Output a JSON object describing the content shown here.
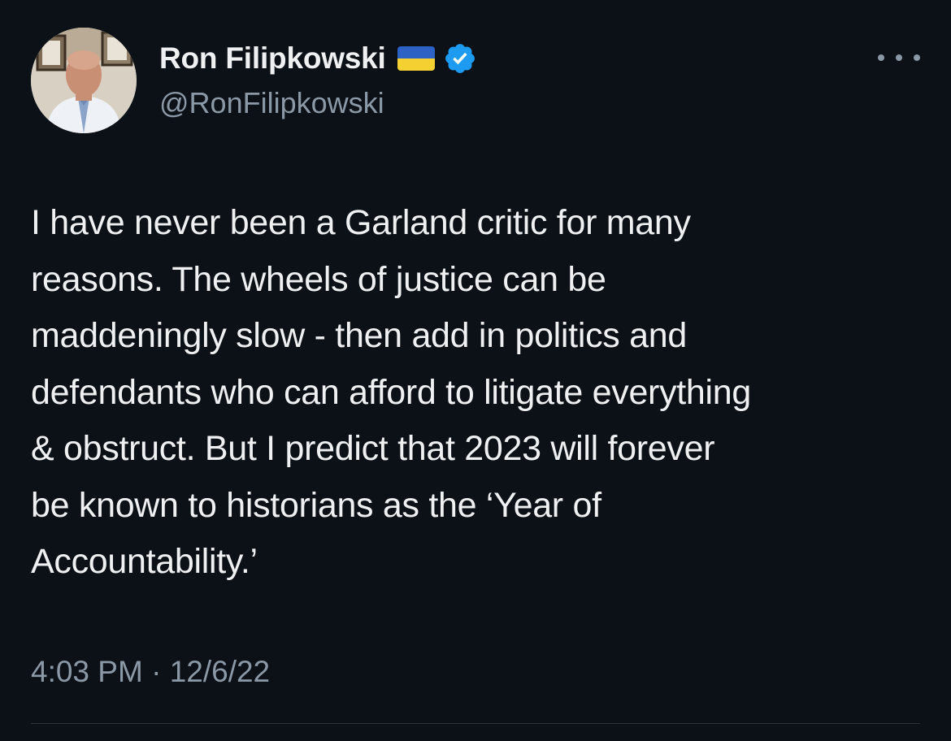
{
  "tweet": {
    "author": {
      "display_name": "Ron Filipkowski",
      "handle": "@RonFilipkowski",
      "flag": "ukraine-flag",
      "verified_icon": "verified-badge-icon"
    },
    "more_icon": "more-options-icon",
    "text": "I have never been a Garland critic for many\nreasons. The wheels of justice can be\nmaddeningly slow - then add in politics and\ndefendants who can afford to litigate everything\n& obstruct. But I predict that 2023 will forever\nbe known to historians as the ‘Year of\nAccountability.’",
    "timestamp": {
      "time": "4:03 PM",
      "separator": "·",
      "date": "12/6/22"
    }
  },
  "colors": {
    "background": "#0c1017",
    "text_primary": "#eef0f2",
    "text_secondary": "#8b98a5",
    "verified_blue": "#1d9bf0",
    "flag_blue": "#2b62c4",
    "flag_yellow": "#f5d033"
  }
}
